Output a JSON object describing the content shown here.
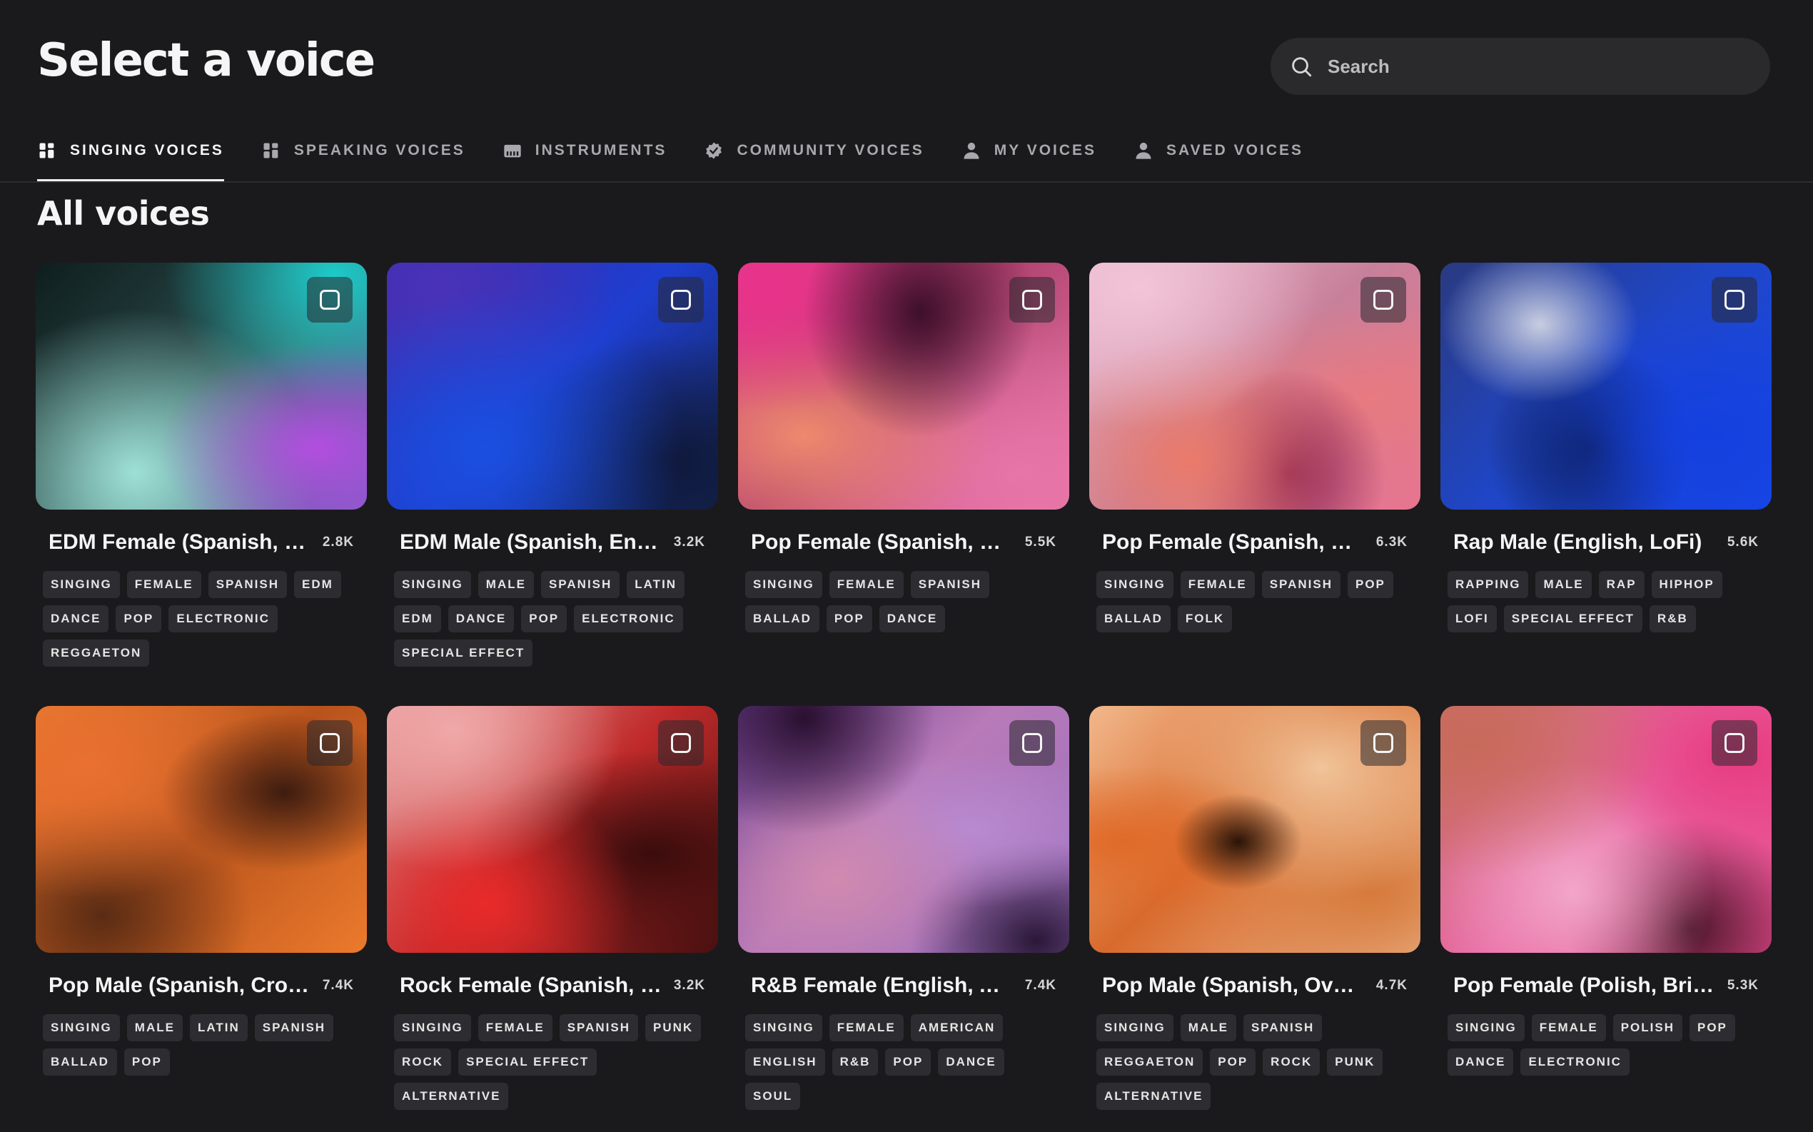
{
  "header": {
    "title": "Select a voice",
    "search_placeholder": "Search"
  },
  "tabs": [
    {
      "label": "SINGING VOICES",
      "icon": "singing-voices-icon",
      "active": true
    },
    {
      "label": "SPEAKING VOICES",
      "icon": "speaking-voices-icon",
      "active": false
    },
    {
      "label": "INSTRUMENTS",
      "icon": "piano-icon",
      "active": false
    },
    {
      "label": "COMMUNITY VOICES",
      "icon": "verified-badge-icon",
      "active": false
    },
    {
      "label": "MY VOICES",
      "icon": "user-icon",
      "active": false
    },
    {
      "label": "SAVED VOICES",
      "icon": "user-icon",
      "active": false
    }
  ],
  "section_title": "All voices",
  "voices": [
    {
      "name": "EDM Female (Spanish, Vi...",
      "plays": "2.8K",
      "tags": [
        "SINGING",
        "FEMALE",
        "SPANISH",
        "EDM",
        "DANCE",
        "POP",
        "ELECTRONIC",
        "REGGAETON"
      ]
    },
    {
      "name": "EDM Male (Spanish, Ener...",
      "plays": "3.2K",
      "tags": [
        "SINGING",
        "MALE",
        "SPANISH",
        "LATIN",
        "EDM",
        "DANCE",
        "POP",
        "ELECTRONIC",
        "SPECIAL EFFECT"
      ]
    },
    {
      "name": "Pop Female (Spanish, Sm...",
      "plays": "5.5K",
      "tags": [
        "SINGING",
        "FEMALE",
        "SPANISH",
        "BALLAD",
        "POP",
        "DANCE"
      ]
    },
    {
      "name": "Pop Female (Spanish, Bal...",
      "plays": "6.3K",
      "tags": [
        "SINGING",
        "FEMALE",
        "SPANISH",
        "POP",
        "BALLAD",
        "FOLK"
      ]
    },
    {
      "name": "Rap Male (English, LoFi)",
      "plays": "5.6K",
      "tags": [
        "RAPPING",
        "MALE",
        "RAP",
        "HIPHOP",
        "LOFI",
        "SPECIAL EFFECT",
        "R&B"
      ]
    },
    {
      "name": "Pop Male (Spanish, Croo...",
      "plays": "7.4K",
      "tags": [
        "SINGING",
        "MALE",
        "LATIN",
        "SPANISH",
        "BALLAD",
        "POP"
      ]
    },
    {
      "name": "Rock Female (Spanish, Di...",
      "plays": "3.2K",
      "tags": [
        "SINGING",
        "FEMALE",
        "SPANISH",
        "PUNK",
        "ROCK",
        "SPECIAL EFFECT",
        "ALTERNATIVE"
      ]
    },
    {
      "name": "R&B Female (English, Atm...",
      "plays": "7.4K",
      "tags": [
        "SINGING",
        "FEMALE",
        "AMERICAN",
        "ENGLISH",
        "R&B",
        "POP",
        "DANCE",
        "SOUL"
      ]
    },
    {
      "name": "Pop Male (Spanish, Overd...",
      "plays": "4.7K",
      "tags": [
        "SINGING",
        "MALE",
        "SPANISH",
        "REGGAETON",
        "POP",
        "ROCK",
        "PUNK",
        "ALTERNATIVE"
      ]
    },
    {
      "name": "Pop Female (Polish, Bright)",
      "plays": "5.3K",
      "tags": [
        "SINGING",
        "FEMALE",
        "POLISH",
        "POP",
        "DANCE",
        "ELECTRONIC"
      ]
    }
  ]
}
